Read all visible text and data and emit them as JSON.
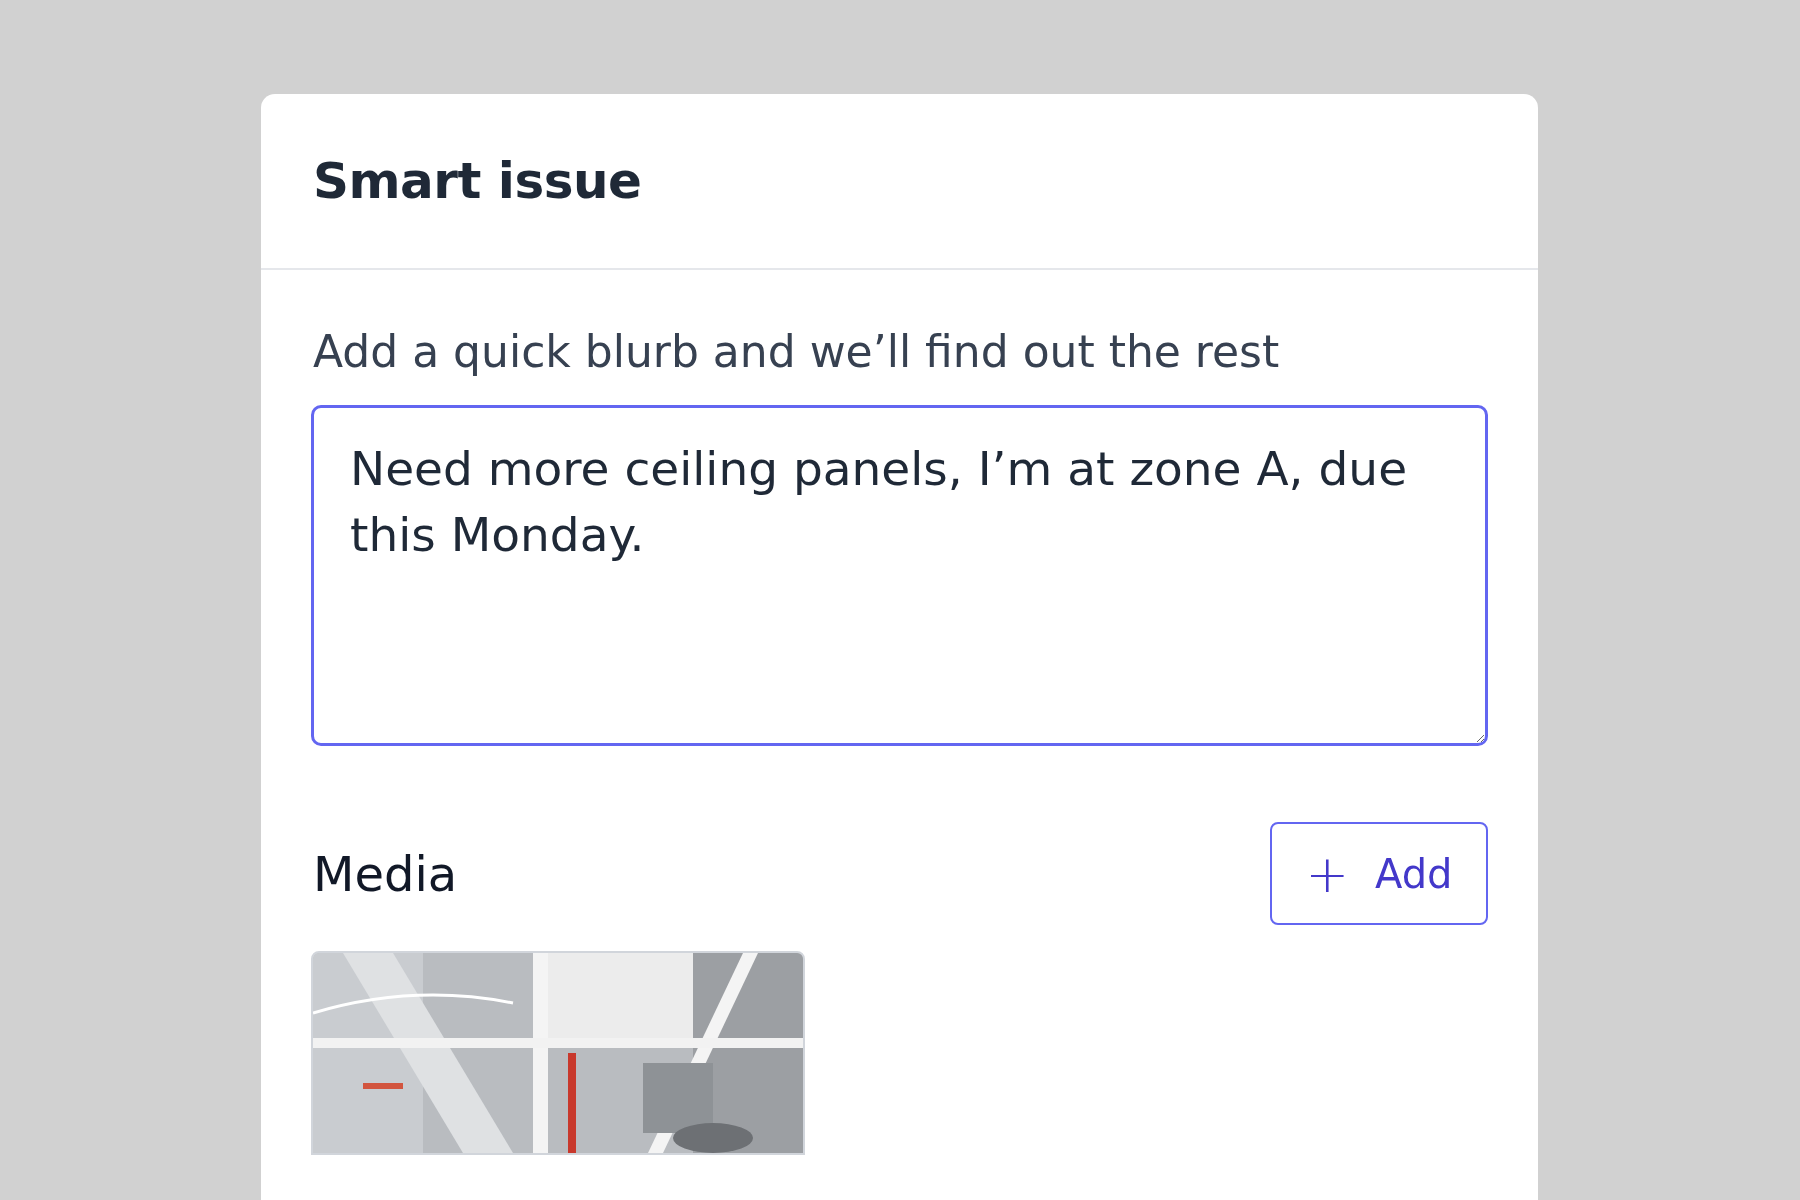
{
  "dialog": {
    "title": "Smart issue"
  },
  "prompt": "Add a quick blurb and we’ll find out the rest",
  "blurb_field": {
    "value": "Need more ceiling panels, I’m at zone A, due this Monday.",
    "focused": true
  },
  "media": {
    "label": "Media",
    "add_button": {
      "icon": "+",
      "label": "Add"
    }
  }
}
